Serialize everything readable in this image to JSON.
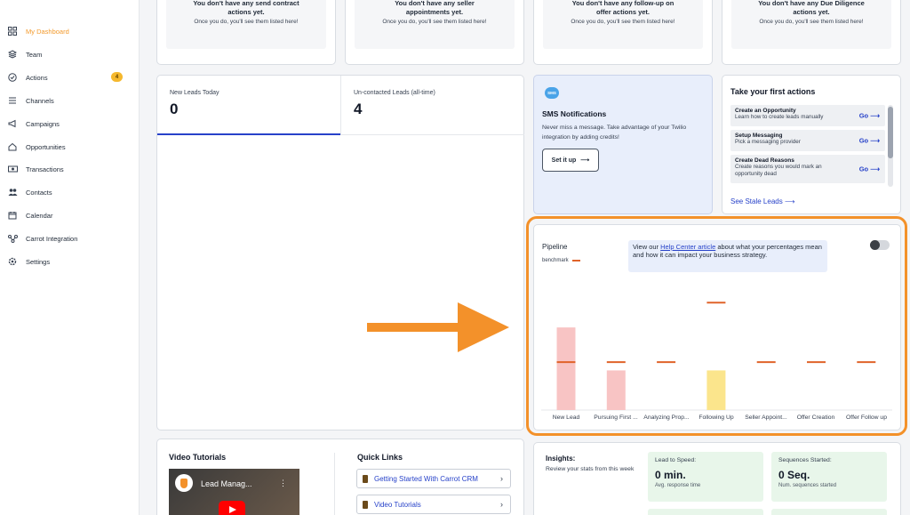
{
  "sidebar": {
    "items": [
      {
        "label": "My Dashboard",
        "icon": "grid-icon"
      },
      {
        "label": "Team",
        "icon": "layers-icon"
      },
      {
        "label": "Actions",
        "icon": "check-circle-icon",
        "badge": "4"
      },
      {
        "label": "Channels",
        "icon": "list-icon"
      },
      {
        "label": "Campaigns",
        "icon": "megaphone-icon"
      },
      {
        "label": "Opportunities",
        "icon": "home-icon"
      },
      {
        "label": "Transactions",
        "icon": "money-icon"
      },
      {
        "label": "Contacts",
        "icon": "people-icon"
      },
      {
        "label": "Calendar",
        "icon": "calendar-icon"
      },
      {
        "label": "Carrot Integration",
        "icon": "integration-icon"
      },
      {
        "label": "Settings",
        "icon": "gear-icon"
      }
    ]
  },
  "empty_states": [
    {
      "title": "You don't have any send contract actions yet.",
      "subtitle": "Once you do, you'll see them listed here!"
    },
    {
      "title": "You don't have any seller appointments yet.",
      "subtitle": "Once you do, you'll see them listed here!"
    },
    {
      "title": "You don't have any follow-up on offer actions yet.",
      "subtitle": "Once you do, you'll see them listed here!"
    },
    {
      "title": "You don't have any Due Diligence actions yet.",
      "subtitle": "Once you do, you'll see them listed here!"
    }
  ],
  "leads": {
    "new_label": "New Leads Today",
    "new_value": "0",
    "uncontacted_label": "Un-contacted Leads (all-time)",
    "uncontacted_value": "4"
  },
  "sms": {
    "icon_text": "SMS",
    "title": "SMS Notifications",
    "description": "Never miss a message. Take advantage of your Twilio integration by adding credits!",
    "button": "Set it up"
  },
  "first_actions": {
    "title": "Take your first actions",
    "items": [
      {
        "title": "Create an Opportunity",
        "desc": "Learn how to create leads manually",
        "go": "Go"
      },
      {
        "title": "Setup Messaging",
        "desc": "Pick a messaging provider",
        "go": "Go"
      },
      {
        "title": "Create Dead Reasons",
        "desc": "Create reasons you would mark an opportunity dead",
        "go": "Go"
      }
    ],
    "link": "See Stale Leads"
  },
  "pipeline": {
    "title": "Pipeline",
    "legend": "benchmark",
    "tooltip_pre": "View our ",
    "tooltip_link": "Help Center article",
    "tooltip_post": " about what your percentages mean and how it can impact your business strategy."
  },
  "chart_data": {
    "type": "bar",
    "categories": [
      "New Lead",
      "Pursuing First ...",
      "Analyzing Prop...",
      "Following Up",
      "Seller Appoint...",
      "Offer Creation",
      "Offer Follow up"
    ],
    "values": [
      100,
      48,
      0,
      48,
      0,
      0,
      0
    ],
    "benchmark": [
      58,
      58,
      58,
      130,
      58,
      58,
      58
    ],
    "colors": [
      "#f8c4c4",
      "#f8c4c4",
      "#f8c4c4",
      "#fbe58c",
      "#f8c4c4",
      "#f8c4c4",
      "#f8c4c4"
    ],
    "benchmark_color": "#e0632a",
    "ylim": [
      0,
      140
    ]
  },
  "video": {
    "title": "Video Tutorials",
    "thumb_text": "Lead Manag..."
  },
  "quick_links": {
    "title": "Quick Links",
    "items": [
      "Getting Started With Carrot CRM",
      "Video Tutorials"
    ]
  },
  "insights": {
    "title": "Insights:",
    "subtitle": "Review your stats from this week",
    "stats": [
      {
        "label": "Lead to Speed:",
        "value": "0 min.",
        "sub": "Avg. response time"
      },
      {
        "label": "Sequences Started:",
        "value": "0 Seq.",
        "sub": "Num. sequences started"
      }
    ]
  }
}
